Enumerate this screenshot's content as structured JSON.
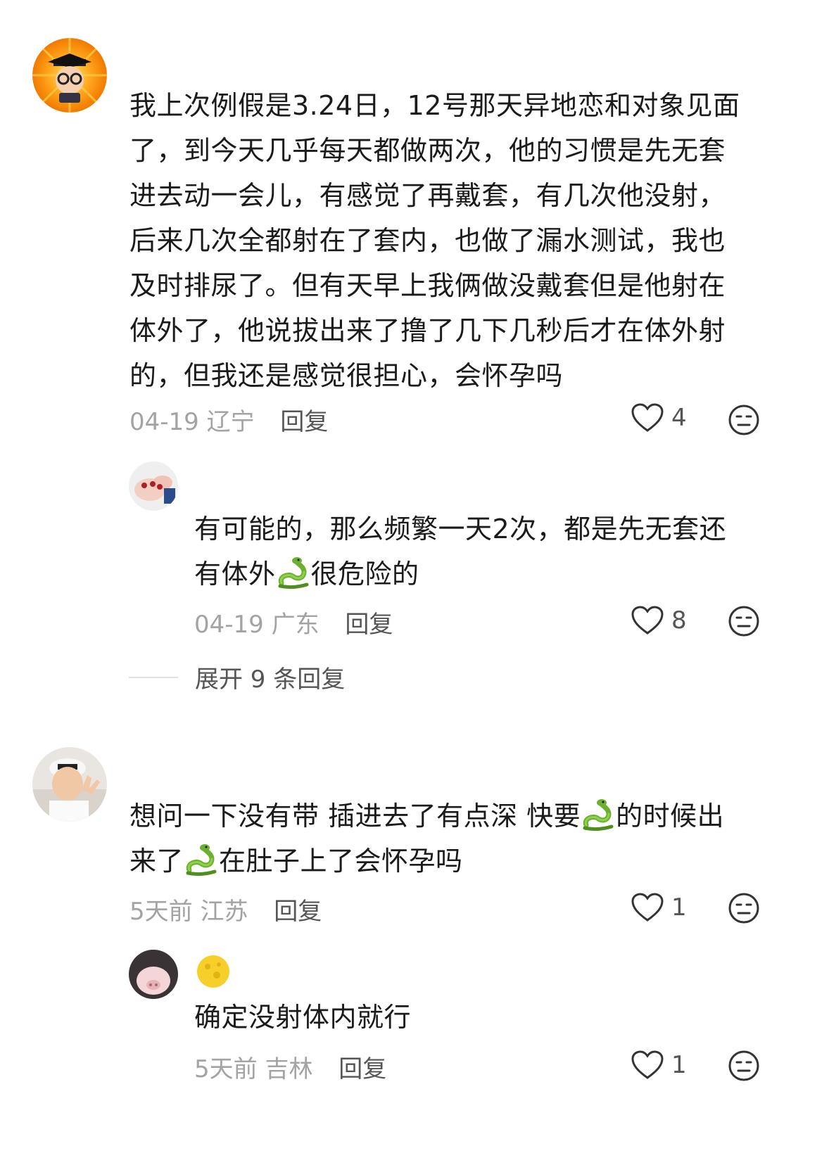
{
  "comments": [
    {
      "lines": [
        "我上次例假是3.24日，12号那天异地恋和对象见面",
        "了，到今天几乎每天都做两次，他的习惯是先无套",
        "进去动一会儿，有感觉了再戴套，有几次他没射，",
        "后来几次全都射在了套内，也做了漏水测试，我也",
        "及时排尿了。但有天早上我俩做没戴套但是他射在",
        "体外了，他说拔出来了撸了几下几秒后才在体外射",
        "的，但我还是感觉很担心，会怀孕吗"
      ],
      "date": "04-19",
      "location": "辽宁",
      "reply_label": "回复",
      "likes": "4",
      "avatar_icon": "graduate-cartoon-avatar"
    },
    {
      "line1": "有可能的，那么频繁一天2次，都是先无套还",
      "line2_before": "有体外",
      "line2_after": "很危险的",
      "date": "04-19",
      "location": "广东",
      "reply_label": "回复",
      "likes": "8",
      "avatar_icon": "hands-nails-avatar"
    },
    {
      "expand_label": "展开 9 条回复"
    },
    {
      "line1_before": "想问一下没有带 插进去了有点深 快要",
      "line1_after": "的时候出",
      "line2_before": "来了",
      "line2_after": "在肚子上了会怀孕吗",
      "date": "5天前",
      "location": "江苏",
      "reply_label": "回复",
      "likes": "1",
      "avatar_icon": "person-cap-avatar"
    },
    {
      "text": "确定没射体内就行",
      "date": "5天前",
      "location": "吉林",
      "reply_label": "回复",
      "likes": "1",
      "avatar_icon": "pig-avatar",
      "badge_icon": "moon-emoji"
    }
  ],
  "icons": {
    "like": "heart-outline-icon",
    "dislike": "neutral-face-icon",
    "snake": "snake-emoji"
  }
}
